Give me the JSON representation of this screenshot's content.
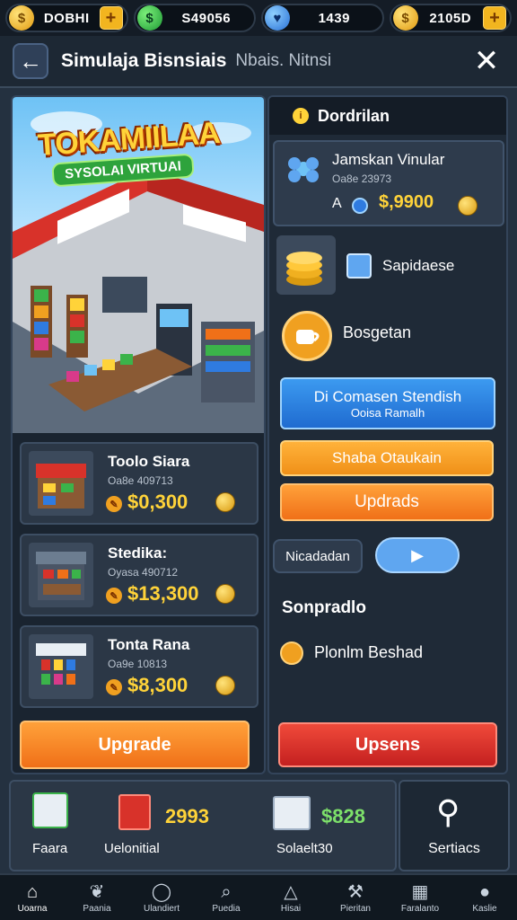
{
  "resources": [
    {
      "icon": "gold-coin-icon",
      "value": "DOBHI",
      "symbol": "$"
    },
    {
      "icon": "gem-icon",
      "value": "S49056",
      "symbol": "$"
    },
    {
      "icon": "heart-icon",
      "value": "1439",
      "symbol": "♥"
    },
    {
      "icon": "coin-icon",
      "value": "2105D",
      "symbol": "$"
    }
  ],
  "header": {
    "title": "Simulaja Bisnsiais",
    "subtitle": "Nbais. Nitnsi"
  },
  "banner": {
    "title": "TOKAMIILAA",
    "subtitle": "SYSOLAI VIRTUAI"
  },
  "items": [
    {
      "name": "Toolo Siara",
      "code": "Oa8e 409713",
      "price": "$0,300"
    },
    {
      "name": "Stedika:",
      "code": "Oyasa 490712",
      "price": "$13,300"
    },
    {
      "name": "Tonta Rana",
      "code": "Oa9e 10813",
      "price": "$8,300"
    }
  ],
  "left_upgrade": "Upgrade",
  "right": {
    "heading": "Dordrilan",
    "feature": {
      "name": "Jamskan Vinular",
      "code": "Oa8e 23973",
      "prefix": "A",
      "price": "$,9900"
    },
    "row1": "Sapidaese",
    "row2": "Bosgetan",
    "blue_btn": {
      "line1": "Di Comasen Stendish",
      "line2": "Ooisa Ramalh"
    },
    "amber_btn": "Shaba Otaukain",
    "orange_btn": "Updrads",
    "toggle": "Nicadadan",
    "section_title": "Sonpradlo",
    "section_item": "Plonlm Beshad",
    "red_btn": "Upsens"
  },
  "stats": [
    {
      "label": "Faara",
      "value": ""
    },
    {
      "label": "Uelonitial",
      "value": "2993"
    },
    {
      "label": "Solaelt30",
      "value": "$828"
    }
  ],
  "services": "Sertiacs",
  "nav": [
    {
      "icon": "home-icon",
      "label": "Uoarna"
    },
    {
      "icon": "leaf-icon",
      "label": "Paania"
    },
    {
      "icon": "chat-icon",
      "label": "Ulandiert"
    },
    {
      "icon": "search-icon",
      "label": "Puedia"
    },
    {
      "icon": "tent-icon",
      "label": "Hisai"
    },
    {
      "icon": "tools-icon",
      "label": "Pieritan"
    },
    {
      "icon": "store-icon",
      "label": "Faralanto"
    },
    {
      "icon": "user-icon",
      "label": "Kaslie"
    }
  ],
  "colors": {
    "accent_gold": "#ffd339",
    "orange": "#f07018",
    "red": "#c42020",
    "blue": "#1f6bd0",
    "bg": "#243140"
  }
}
